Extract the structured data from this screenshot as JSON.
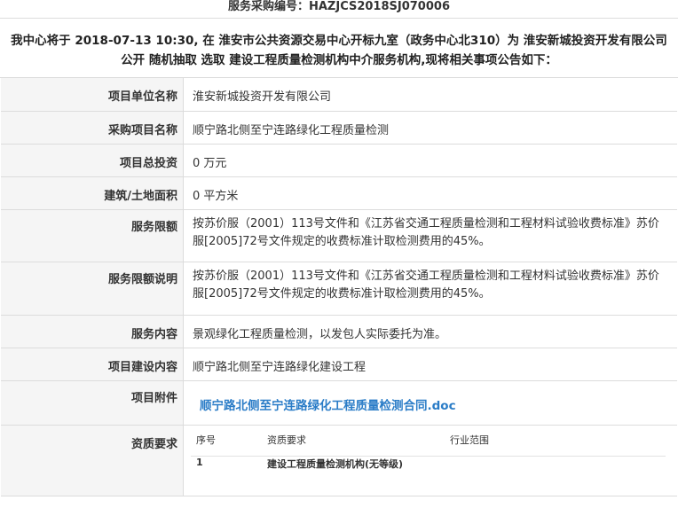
{
  "header": {
    "procurement_no": "服务采购编号：HAZJCS2018SJ070006",
    "intro": "我中心将于 2018-07-13 10:30, 在 淮安市公共资源交易中心开标九室（政务中心北310）为 淮安新城投资开发有限公司 公开 随机抽取 选取 建设工程质量检测机构中介服务机构,现将相关事项公告如下："
  },
  "rows": {
    "unit": {
      "label": "项目单位名称",
      "value": "淮安新城投资开发有限公司"
    },
    "project": {
      "label": "采购项目名称",
      "value": "顺宁路北侧至宁连路绿化工程质量检测"
    },
    "investment": {
      "label": "项目总投资",
      "value": "0 万元"
    },
    "area": {
      "label": "建筑/土地面积",
      "value": "0 平方米"
    },
    "limit": {
      "label": "服务限额",
      "value": "按苏价服（2001）113号文件和《江苏省交通工程质量检测和工程材料试验收费标准》苏价服[2005]72号文件规定的收费标准计取检测费用的45%。"
    },
    "limit_desc": {
      "label": "服务限额说明",
      "value": "按苏价服（2001）113号文件和《江苏省交通工程质量检测和工程材料试验收费标准》苏价服[2005]72号文件规定的收费标准计取检测费用的45%。"
    },
    "content": {
      "label": "服务内容",
      "value": "景观绿化工程质量检测，以发包人实际委托为准。"
    },
    "construction": {
      "label": "项目建设内容",
      "value": "顺宁路北侧至宁连路绿化建设工程"
    },
    "attachment": {
      "label": "项目附件",
      "link": "顺宁路北侧至宁连路绿化工程质量检测合同.doc"
    },
    "qualification": {
      "label": "资质要求",
      "headers": [
        "序号",
        "资质要求",
        "行业范围"
      ],
      "rows": [
        {
          "no": "1",
          "req": "建设工程质量检测机构(无等级)",
          "scope": ""
        }
      ]
    }
  }
}
